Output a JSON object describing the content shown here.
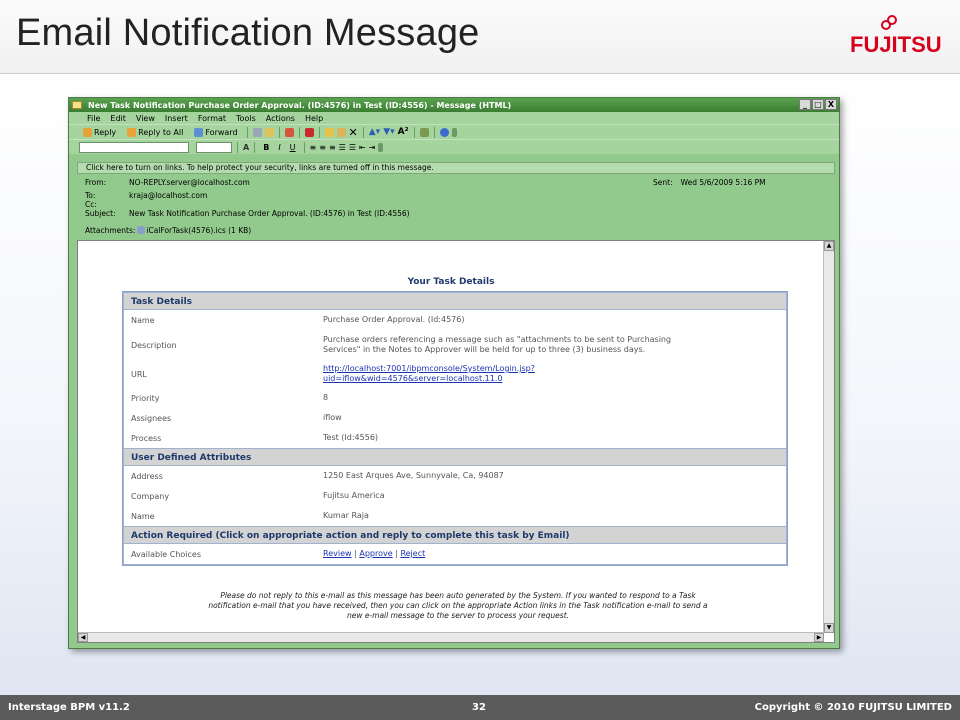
{
  "slide": {
    "title": "Email Notification Message",
    "logo_text": "FUJITSU",
    "footer_left": "Interstage BPM v11.2",
    "page_number": "32",
    "footer_right": "Copyright © 2010 FUJITSU LIMITED"
  },
  "window": {
    "title": "New Task Notification Purchase Order Approval. (ID:4576) in Test (ID:4556) - Message (HTML)",
    "controls": [
      "_",
      "□",
      "X"
    ],
    "menu": [
      "File",
      "Edit",
      "View",
      "Insert",
      "Format",
      "Tools",
      "Actions",
      "Help"
    ],
    "toolbar": {
      "reply": "Reply",
      "reply_all": "Reply to All",
      "forward": "Forward"
    },
    "format_bar": {
      "bold": "B",
      "italic": "I",
      "underline": "U"
    },
    "infobar": "Click here to turn on links. To help protect your security, links are turned off in this message."
  },
  "email": {
    "from_label": "From:",
    "from": "NO-REPLY.server@localhost.com",
    "to_label": "To:",
    "to": "kraja@localhost.com",
    "cc_label": "Cc:",
    "cc": "",
    "subject_label": "Subject:",
    "subject": "New Task Notification Purchase Order Approval. (ID:4576) in Test (ID:4556)",
    "attachments_label": "Attachments:",
    "attachment": "iCalForTask(4576).ics (1 KB)",
    "sent_label": "Sent:",
    "sent": "Wed 5/6/2009 5:16 PM"
  },
  "body": {
    "heading": "Your Task Details",
    "task_details": {
      "header": "Task Details",
      "name_label": "Name",
      "name": "Purchase Order Approval. (Id:4576)",
      "description_label": "Description",
      "description_line1": "Purchase orders referencing a message such as \"attachments to be sent to Purchasing",
      "description_line2": "Services\" in the Notes to Approver will be held for up to three (3) business days.",
      "url_label": "URL",
      "url_line1": "http://localhost:7001/ibpmconsole/System/Login.jsp?",
      "url_line2": "uid=iflow&wid=4576&server=localhost.11.0",
      "priority_label": "Priority",
      "priority": "8",
      "assignees_label": "Assignees",
      "assignees": "iflow",
      "process_label": "Process",
      "process": "Test (Id:4556)"
    },
    "user_defined": {
      "header": "User Defined Attributes",
      "address_label": "Address",
      "address": "1250 East Arques Ave, Sunnyvale, Ca, 94087",
      "company_label": "Company",
      "company": "Fujitsu America",
      "name_label": "Name",
      "name": "Kumar Raja"
    },
    "action": {
      "header": "Action Required (Click on appropriate action and reply to complete this task by Email)",
      "choices_label": "Available Choices",
      "review": "Review",
      "approve": "Approve",
      "reject": "Reject",
      "separator": "|"
    },
    "disclaimer_line1": "Please do not reply to this e-mail as this message has been auto generated by the System. If you wanted to respond to a Task",
    "disclaimer_line2": "notification e-mail that you have received, then you can click on the appropriate Action links in the Task notification e-mail to send a",
    "disclaimer_line3": "new e-mail message to the server to process your request."
  },
  "colors": {
    "window_green": "#92c98c",
    "section_header_text": "#1e3a6a",
    "link": "#1a33b0",
    "logo_red": "#d7001d"
  }
}
